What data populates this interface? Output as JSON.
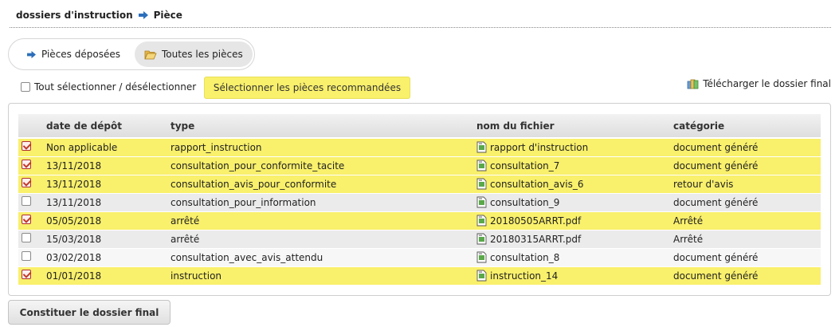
{
  "breadcrumb": {
    "parent": "dossiers d'instruction",
    "current": "Pièce"
  },
  "tabs": [
    {
      "label": "Pièces déposées",
      "icon": "arrow-right-icon",
      "active": false
    },
    {
      "label": "Toutes les pièces",
      "icon": "folder-open-icon",
      "active": true
    }
  ],
  "toolbar": {
    "select_all_label": "Tout sélectionner / désélectionner",
    "recommended_button": "Sélectionner les pièces recommandées",
    "download_label": "Télécharger le dossier final"
  },
  "table": {
    "columns": [
      "",
      "date de dépôt",
      "type",
      "nom du fichier",
      "catégorie"
    ],
    "rows": [
      {
        "checked": true,
        "date": "Non applicable",
        "type": "rapport_instruction",
        "file": "rapport d'instruction",
        "category": "document généré"
      },
      {
        "checked": true,
        "date": "13/11/2018",
        "type": "consultation_pour_conformite_tacite",
        "file": "consultation_7",
        "category": "document généré"
      },
      {
        "checked": true,
        "date": "13/11/2018",
        "type": "consultation_avis_pour_conformite",
        "file": "consultation_avis_6",
        "category": "retour d'avis"
      },
      {
        "checked": false,
        "date": "13/11/2018",
        "type": "consultation_pour_information",
        "file": "consultation_9",
        "category": "document généré"
      },
      {
        "checked": true,
        "date": "05/05/2018",
        "type": "arrêté",
        "file": "20180505ARRT.pdf",
        "category": "Arrêté"
      },
      {
        "checked": false,
        "date": "15/03/2018",
        "type": "arrêté",
        "file": "20180315ARRT.pdf",
        "category": "Arrêté"
      },
      {
        "checked": false,
        "date": "03/02/2018",
        "type": "consultation_avec_avis_attendu",
        "file": "consultation_8",
        "category": "document généré"
      },
      {
        "checked": true,
        "date": "01/01/2018",
        "type": "instruction",
        "file": "instruction_14",
        "category": "document généré"
      }
    ]
  },
  "final_button": "Constituer le dossier final",
  "colors": {
    "highlight": "#f9f06c",
    "arrow_blue": "#2c6fbb",
    "check_red": "#c0392b"
  }
}
